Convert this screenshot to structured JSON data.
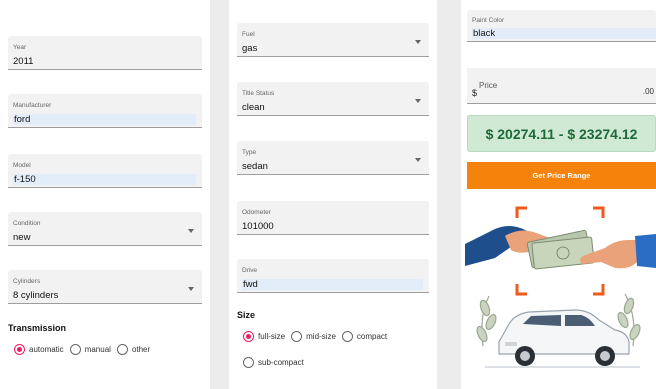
{
  "left_panel": {
    "year": {
      "label": "Year",
      "value": "2011"
    },
    "manufacturer": {
      "label": "Manufacturer",
      "value": "ford"
    },
    "model": {
      "label": "Model",
      "value": "f-150"
    },
    "condition": {
      "label": "Condition",
      "value": "new"
    },
    "cylinders": {
      "label": "Cylinders",
      "value": "8 cylinders"
    },
    "transmission": {
      "title": "Transmission",
      "options": [
        "automatic",
        "manual",
        "other"
      ],
      "selected": "automatic"
    }
  },
  "middle_panel": {
    "fuel": {
      "label": "Fuel",
      "value": "gas"
    },
    "title_status": {
      "label": "Title Status",
      "value": "clean"
    },
    "type": {
      "label": "Type",
      "value": "sedan"
    },
    "odometer": {
      "label": "Odometer",
      "value": "101000"
    },
    "drive": {
      "label": "Drive",
      "value": "fwd"
    },
    "size": {
      "title": "Size",
      "options": [
        "full-size",
        "mid-size",
        "compact",
        "sub-compact"
      ],
      "selected": "full-size"
    }
  },
  "right_panel": {
    "paint_color": {
      "label": "Paint Color",
      "value": "black"
    },
    "price": {
      "currency": "$",
      "label": "Price",
      "decimal": ".00"
    },
    "price_range": "$ 20274.11 - $ 23274.12",
    "get_button_label": "Get Price Range"
  },
  "colors": {
    "accent_radio": "#e91e63",
    "button": "#f5820a",
    "range_bg": "#cfe9d4",
    "range_text": "#1d6a37",
    "autofill": "#e3edf9"
  },
  "icons": [
    "dropdown-caret-icon",
    "money-handshake-illustration",
    "car-illustration"
  ]
}
